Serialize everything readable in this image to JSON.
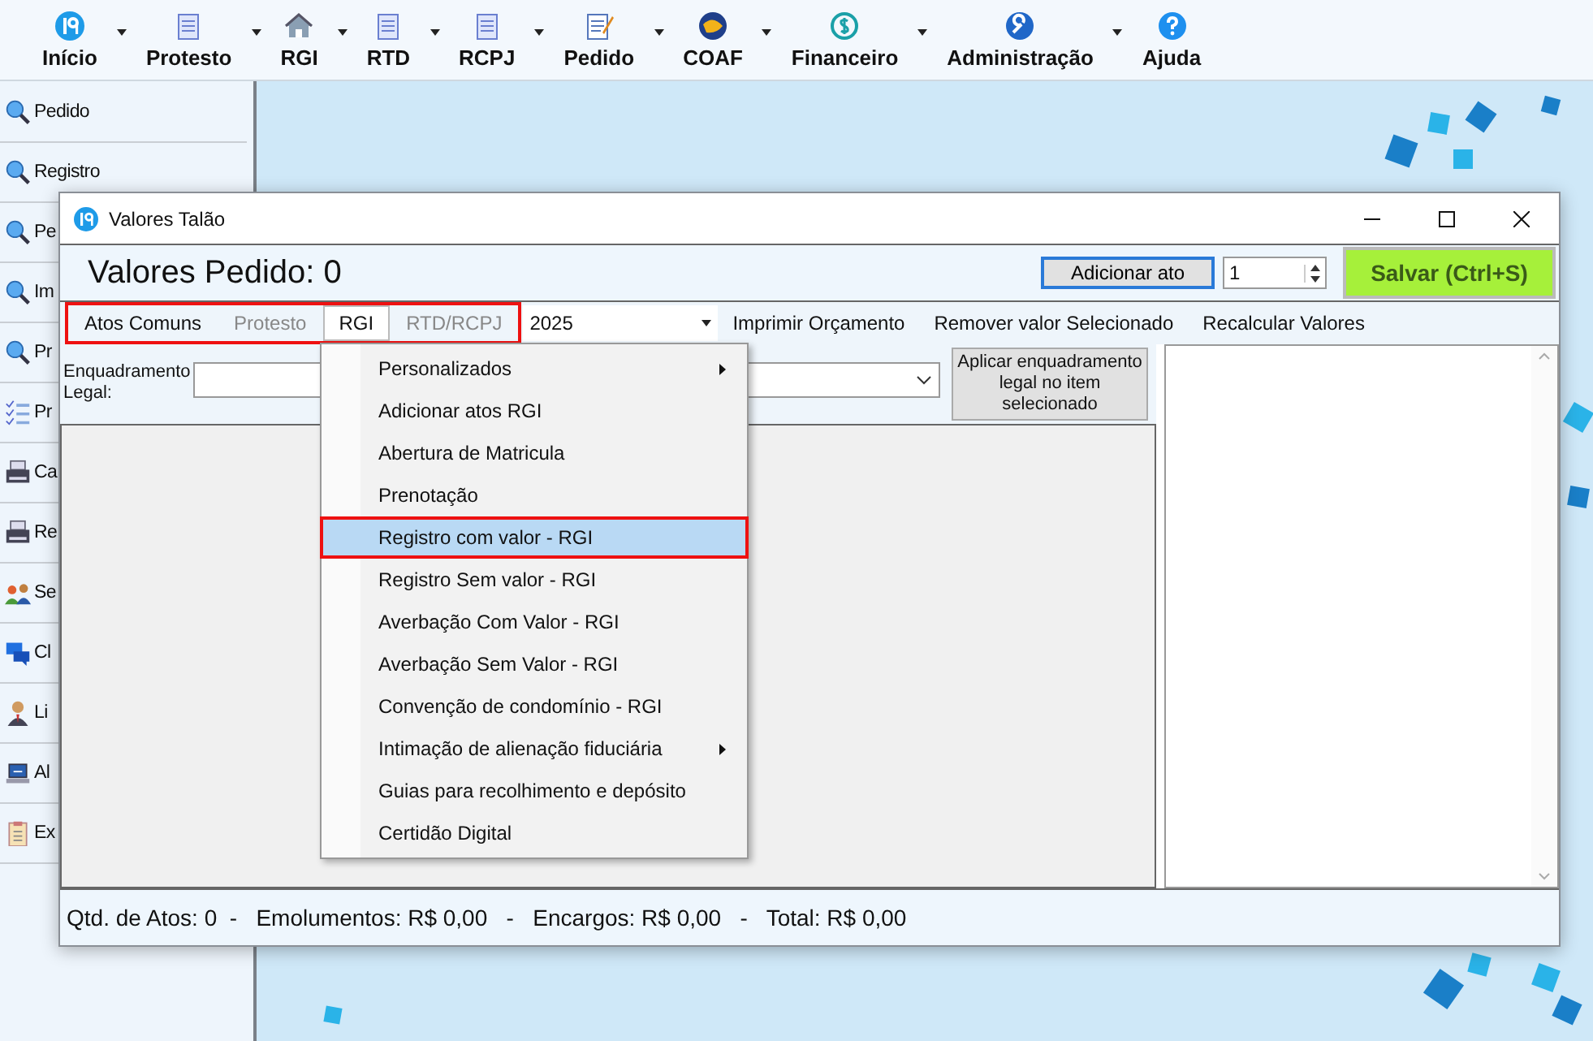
{
  "toolbar": [
    {
      "label": "Início",
      "has_menu": true
    },
    {
      "label": "Protesto",
      "has_menu": true
    },
    {
      "label": "RGI",
      "has_menu": true
    },
    {
      "label": "RTD",
      "has_menu": true
    },
    {
      "label": "RCPJ",
      "has_menu": true
    },
    {
      "label": "Pedido",
      "has_menu": true
    },
    {
      "label": "COAF",
      "has_menu": true
    },
    {
      "label": "Financeiro",
      "has_menu": true
    },
    {
      "label": "Administração",
      "has_menu": true
    },
    {
      "label": "Ajuda",
      "has_menu": false
    }
  ],
  "sidebar": {
    "items": [
      {
        "label": "Pedido"
      },
      {
        "label": "Registro"
      },
      {
        "label": "Pe"
      },
      {
        "label": "Im"
      },
      {
        "label": "Pr"
      },
      {
        "label": "Pr"
      },
      {
        "label": "Ca"
      },
      {
        "label": "Re"
      },
      {
        "label": "Se"
      },
      {
        "label": "Cl"
      },
      {
        "label": "Li"
      },
      {
        "label": "Al"
      },
      {
        "label": "Ex"
      }
    ]
  },
  "dialog": {
    "title": "Valores Talão",
    "heading": "Valores Pedido: 0",
    "add_button": "Adicionar ato",
    "quantity": "1",
    "save_button": "Salvar (Ctrl+S)",
    "tabs_highlighted": true,
    "tabs": [
      {
        "label": "Atos Comuns",
        "selected": false,
        "disabled": false
      },
      {
        "label": "Protesto",
        "selected": false,
        "disabled": true
      },
      {
        "label": "RGI",
        "selected": true,
        "disabled": false
      },
      {
        "label": "RTD/RCPJ",
        "selected": false,
        "disabled": true
      }
    ],
    "year": "2025",
    "actions": [
      "Imprimir Orçamento",
      "Remover valor Selecionado",
      "Recalcular Valores"
    ],
    "legal_label": "Enquadramento Legal:",
    "apply_button": "Aplicar enquadramento legal no item selecionado",
    "status": "Qtd. de Atos: 0  -   Emolumentos: R$ 0,00   -   Encargos: R$ 0,00   -   Total: R$ 0,00"
  },
  "menu": {
    "items": [
      {
        "label": "Personalizados",
        "submenu": true,
        "selected": false,
        "highlighted": false
      },
      {
        "label": "Adicionar atos RGI",
        "submenu": false,
        "selected": false,
        "highlighted": false
      },
      {
        "label": "Abertura de Matricula",
        "submenu": false,
        "selected": false,
        "highlighted": false
      },
      {
        "label": "Prenotação",
        "submenu": false,
        "selected": false,
        "highlighted": false
      },
      {
        "label": "Registro com valor - RGI",
        "submenu": false,
        "selected": true,
        "highlighted": true
      },
      {
        "label": "Registro Sem valor - RGI",
        "submenu": false,
        "selected": false,
        "highlighted": false
      },
      {
        "label": "Averbação Com Valor - RGI",
        "submenu": false,
        "selected": false,
        "highlighted": false
      },
      {
        "label": "Averbação Sem Valor - RGI",
        "submenu": false,
        "selected": false,
        "highlighted": false
      },
      {
        "label": "Convenção de condomínio - RGI",
        "submenu": false,
        "selected": false,
        "highlighted": false
      },
      {
        "label": "Intimação de alienação fiduciária",
        "submenu": true,
        "selected": false,
        "highlighted": false
      },
      {
        "label": "Guias para recolhimento e depósito",
        "submenu": false,
        "selected": false,
        "highlighted": false
      },
      {
        "label": "Certidão Digital",
        "submenu": false,
        "selected": false,
        "highlighted": false
      }
    ]
  }
}
